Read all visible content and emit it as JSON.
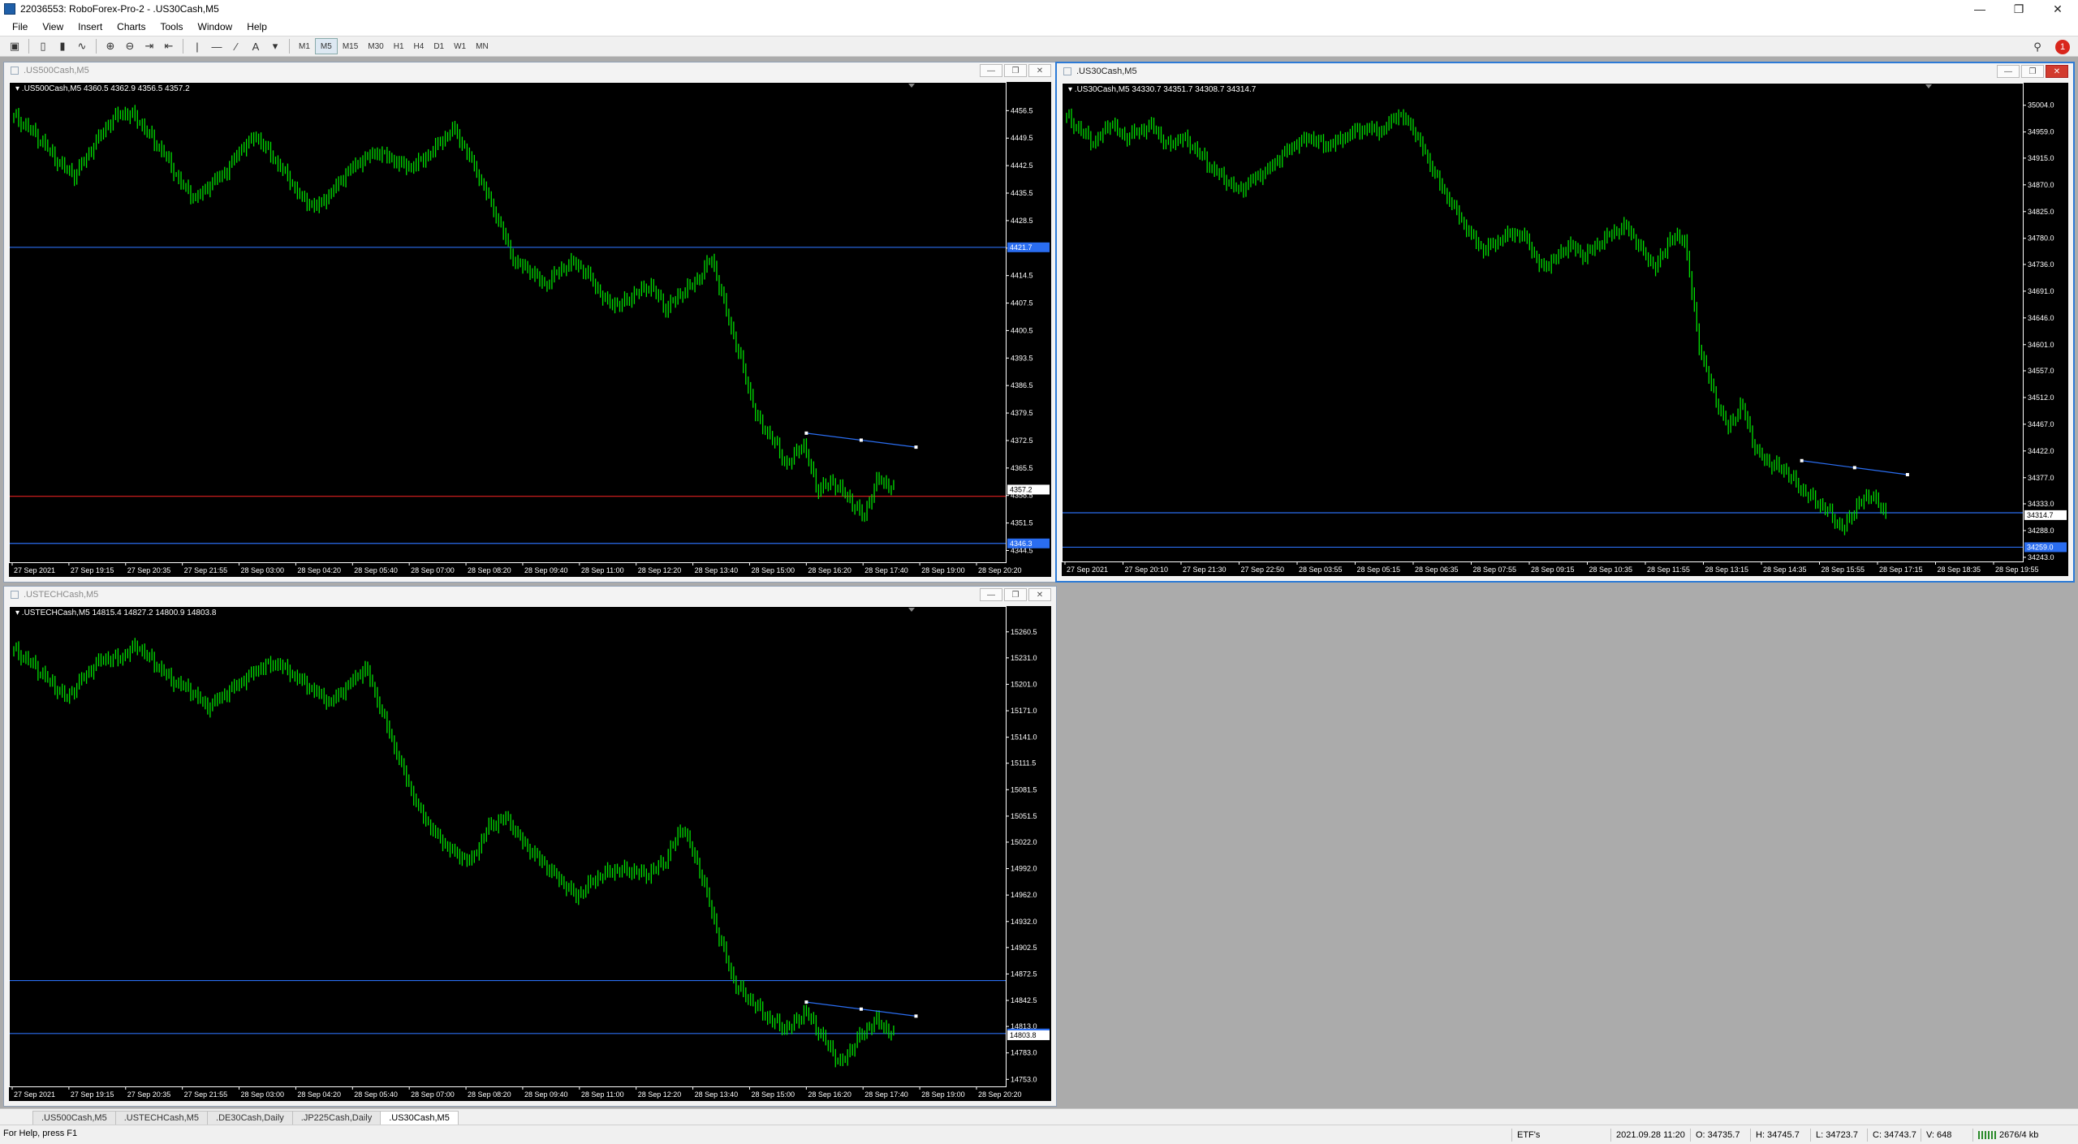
{
  "window": {
    "title": "22036553: RoboForex-Pro-2 - .US30Cash,M5"
  },
  "menu": [
    "File",
    "View",
    "Insert",
    "Charts",
    "Tools",
    "Window",
    "Help"
  ],
  "timeframes": [
    "M1",
    "M5",
    "M15",
    "M30",
    "H1",
    "H4",
    "D1",
    "W1",
    "MN"
  ],
  "active_timeframe": "M5",
  "notification_count": "1",
  "charts": [
    {
      "title": ".US500Cash,M5",
      "info": ".US500Cash,M5  4360.5 4362.9 4356.5 4357.2",
      "active": false,
      "ymin": 4341.5,
      "ymax": 4460.5,
      "yticks": [
        "4456.5",
        "4449.5",
        "4442.5",
        "4435.5",
        "4428.5",
        "4421.5",
        "4414.5",
        "4407.5",
        "4400.5",
        "4393.5",
        "4386.5",
        "4379.5",
        "4372.5",
        "4365.5",
        "4358.5",
        "4351.5",
        "4344.5"
      ],
      "xticks": [
        "27 Sep 2021",
        "27 Sep 19:15",
        "27 Sep 20:35",
        "27 Sep 21:55",
        "28 Sep 03:00",
        "28 Sep 04:20",
        "28 Sep 05:40",
        "28 Sep 07:00",
        "28 Sep 08:20",
        "28 Sep 09:40",
        "28 Sep 11:00",
        "28 Sep 12:20",
        "28 Sep 13:40",
        "28 Sep 15:00",
        "28 Sep 16:20",
        "28 Sep 17:40",
        "28 Sep 19:00",
        "28 Sep 20:20"
      ],
      "price_label": "4357.2",
      "hline_blue": 4421.7,
      "hline_red": 4358.3,
      "hline_blue2": 4346.3,
      "hline_blue_label": "4421.7",
      "hline_blue2_label": "4346.3",
      "path": [
        4455,
        4452,
        4448,
        4443,
        4440,
        4446,
        4452,
        4456,
        4455,
        4450,
        4445,
        4438,
        4434,
        4438,
        4441,
        4447,
        4450,
        4445,
        4440,
        4434,
        4432,
        4436,
        4441,
        4444,
        4446,
        4444,
        4442,
        4444,
        4448,
        4452,
        4445,
        4437,
        4428,
        4418,
        4416,
        4412,
        4416,
        4418,
        4414,
        4408,
        4407,
        4410,
        4412,
        4406,
        4410,
        4413,
        4419,
        4405,
        4392,
        4378,
        4373,
        4366,
        4372,
        4360,
        4362,
        4358,
        4353,
        4363,
        4360
      ]
    },
    {
      "title": ".US30Cash,M5",
      "info": ".US30Cash,M5  34330.7 34351.7 34308.7 34314.7",
      "active": true,
      "ymin": 34236.0,
      "ymax": 35020.0,
      "yticks": [
        "35004.0",
        "34959.0",
        "34915.0",
        "34870.0",
        "34825.0",
        "34780.0",
        "34736.0",
        "34691.0",
        "34646.0",
        "34601.0",
        "34557.0",
        "34512.0",
        "34467.0",
        "34422.0",
        "34377.0",
        "34333.0",
        "34288.0",
        "34243.0"
      ],
      "xticks": [
        "27 Sep 2021",
        "27 Sep 20:10",
        "27 Sep 21:30",
        "27 Sep 22:50",
        "28 Sep 03:55",
        "28 Sep 05:15",
        "28 Sep 06:35",
        "28 Sep 07:55",
        "28 Sep 09:15",
        "28 Sep 10:35",
        "28 Sep 11:55",
        "28 Sep 13:15",
        "28 Sep 14:35",
        "28 Sep 15:55",
        "28 Sep 17:15",
        "28 Sep 18:35",
        "28 Sep 19:55"
      ],
      "price_label": "34314.7",
      "hline_blue": 34318.0,
      "hline_red": null,
      "hline_blue2": 34260.0,
      "hline_blue_label": "",
      "hline_blue2_label": "34259.0",
      "path": [
        34985,
        34960,
        34940,
        34975,
        34950,
        34960,
        34970,
        34935,
        34950,
        34930,
        34900,
        34880,
        34860,
        34880,
        34895,
        34920,
        34940,
        34950,
        34935,
        34945,
        34960,
        34965,
        34960,
        34990,
        34970,
        34920,
        34870,
        34830,
        34790,
        34760,
        34775,
        34790,
        34780,
        34730,
        34745,
        34770,
        34750,
        34770,
        34790,
        34800,
        34760,
        34730,
        34780,
        34780,
        34600,
        34520,
        34460,
        34500,
        34420,
        34400,
        34390,
        34360,
        34340,
        34320,
        34290,
        34330,
        34350,
        34314
      ]
    },
    {
      "title": ".USTECHCash,M5",
      "info": ".USTECHCash,M5  14815.4 14827.2 14800.9 14803.8",
      "active": false,
      "ymin": 14745.0,
      "ymax": 15275.0,
      "yticks": [
        "15260.5",
        "15231.0",
        "15201.0",
        "15171.0",
        "15141.0",
        "15111.5",
        "15081.5",
        "15051.5",
        "15022.0",
        "14992.0",
        "14962.0",
        "14932.0",
        "14902.5",
        "14872.5",
        "14842.5",
        "14813.0",
        "14783.0",
        "14753.0"
      ],
      "xticks": [
        "27 Sep 2021",
        "27 Sep 19:15",
        "27 Sep 20:35",
        "27 Sep 21:55",
        "28 Sep 03:00",
        "28 Sep 04:20",
        "28 Sep 05:40",
        "28 Sep 07:00",
        "28 Sep 08:20",
        "28 Sep 09:40",
        "28 Sep 11:00",
        "28 Sep 12:20",
        "28 Sep 13:40",
        "28 Sep 15:00",
        "28 Sep 16:20",
        "28 Sep 17:40",
        "28 Sep 19:00",
        "28 Sep 20:20"
      ],
      "price_label": "14803.8",
      "hline_blue": 14865.0,
      "hline_red": null,
      "hline_blue2": 14805.0,
      "hline_blue_label": "",
      "hline_blue2_label": "14813.0",
      "path": [
        15240,
        15225,
        15205,
        15185,
        15210,
        15230,
        15230,
        15245,
        15225,
        15205,
        15195,
        15175,
        15190,
        15205,
        15220,
        15225,
        15210,
        15195,
        15180,
        15200,
        15220,
        15165,
        15110,
        15060,
        15030,
        15010,
        15000,
        15040,
        15050,
        15020,
        15000,
        14980,
        14960,
        14980,
        14990,
        14990,
        14985,
        15000,
        15040,
        14990,
        14920,
        14860,
        14840,
        14820,
        14810,
        14830,
        14800,
        14770,
        14800,
        14820,
        14803
      ]
    }
  ],
  "tabs": [
    ".US500Cash,M5",
    ".USTECHCash,M5",
    ".DE30Cash,Daily",
    ".JP225Cash,Daily",
    ".US30Cash,M5"
  ],
  "active_tab": ".US30Cash,M5",
  "status": {
    "help": "For Help, press F1",
    "profile": "ETF's",
    "datetime": "2021.09.28 11:20",
    "open": "O: 34735.7",
    "high": "H: 34745.7",
    "low": "L: 34723.7",
    "close": "C: 34743.7",
    "volume": "V: 648",
    "traffic": "2676/4 kb"
  },
  "colors": {
    "candle": "#00e000",
    "line_blue": "#2a6df0",
    "line_red": "#e02020",
    "chart_bg": "#000000"
  }
}
